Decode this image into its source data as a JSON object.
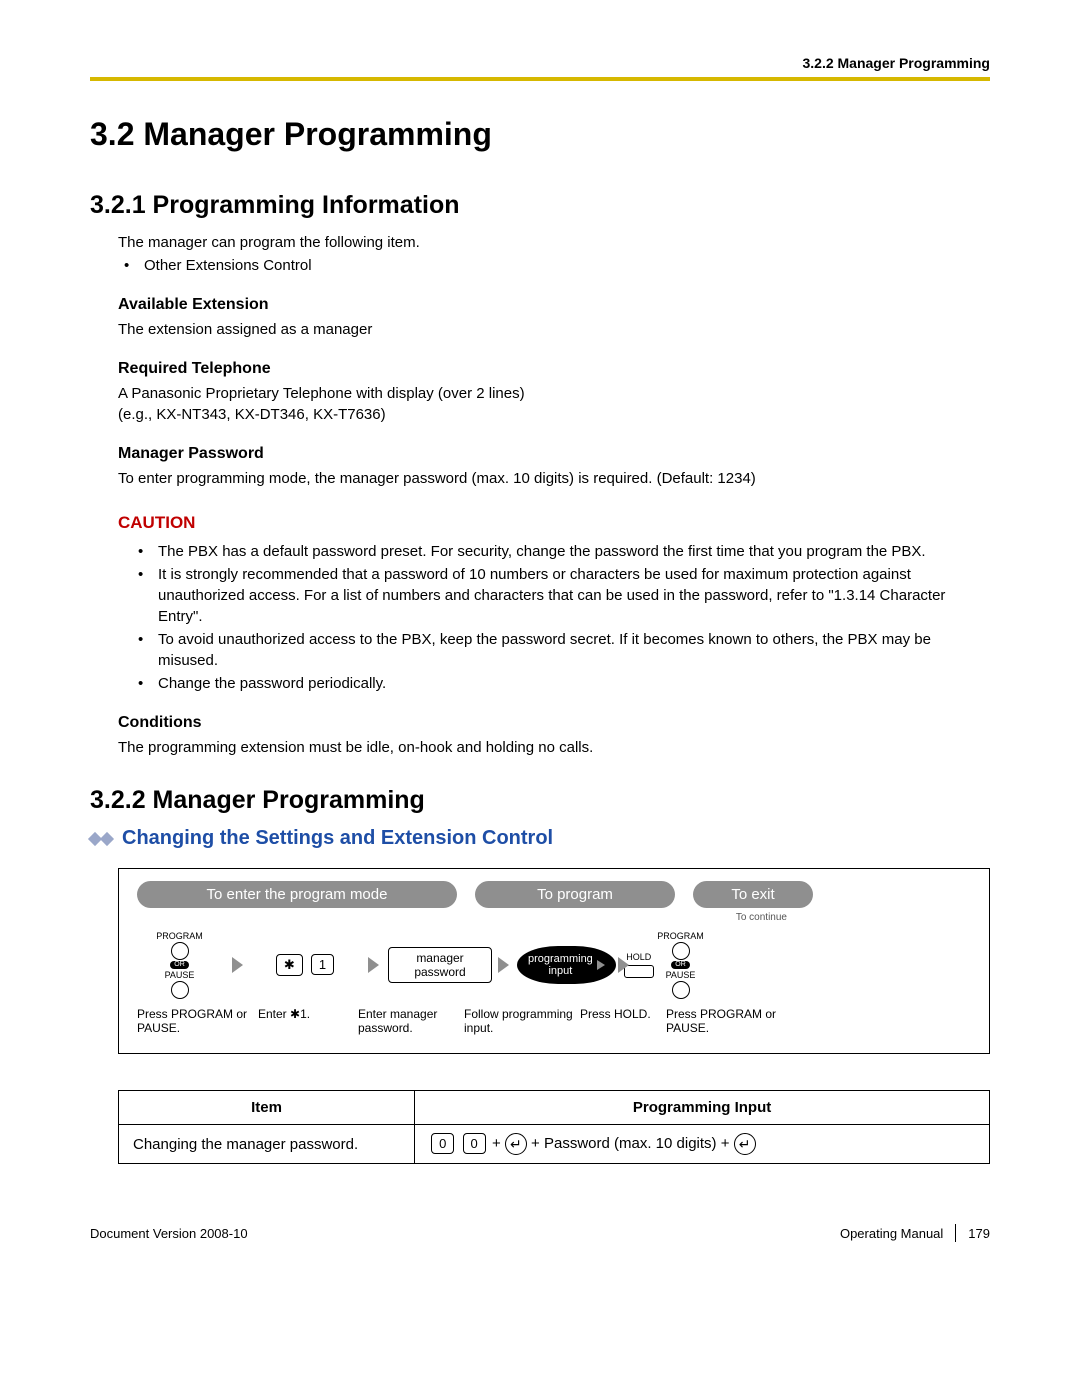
{
  "header": {
    "section_ref": "3.2.2 Manager Programming"
  },
  "h1": "3.2  Manager Programming",
  "s1": {
    "title": "3.2.1  Programming Information",
    "intro": "The manager can program the following item.",
    "intro_bullet": "Other Extensions Control",
    "available_ext_head": "Available Extension",
    "available_ext_body": "The extension assigned as a manager",
    "req_tel_head": "Required Telephone",
    "req_tel_body1": "A Panasonic Proprietary Telephone with display (over 2 lines)",
    "req_tel_body2": "(e.g., KX-NT343, KX-DT346, KX-T7636)",
    "mgr_pw_head": "Manager Password",
    "mgr_pw_body": "To enter programming mode, the manager password (max. 10 digits) is required. (Default: 1234)",
    "caution_label": "CAUTION",
    "caution": [
      "The PBX has a default password preset. For security, change the password the first time that you program the PBX.",
      "It is strongly recommended that a password of 10 numbers or characters be used for maximum protection against unauthorized access. For a list of numbers and characters that can be used in the password, refer to \"1.3.14  Character Entry\".",
      "To avoid unauthorized access to the PBX, keep the password secret. If it becomes known to others, the PBX may be misused.",
      "Change the password periodically."
    ],
    "cond_head": "Conditions",
    "cond_body": "The programming extension must be idle, on-hook and holding no calls."
  },
  "s2": {
    "title": "3.2.2  Manager Programming",
    "subtitle": "Changing the Settings and Extension Control",
    "pills": {
      "enter": "To enter the program mode",
      "program": "To program",
      "exit": "To exit"
    },
    "btn_program": "PROGRAM",
    "btn_or": "OR",
    "btn_pause": "PAUSE",
    "key_star": "✱",
    "key_one": "1",
    "field_mgrpw": "manager password",
    "oval_text": "programming input",
    "to_continue": "To continue",
    "hold_label": "HOLD",
    "captions": {
      "c1": "Press PROGRAM or PAUSE.",
      "c2": "Enter ✱1.",
      "c3": "Enter manager password.",
      "c4": "Follow programming input.",
      "c5": "Press HOLD.",
      "c6": "Press PROGRAM or PAUSE."
    }
  },
  "table": {
    "head_item": "Item",
    "head_input": "Programming Input",
    "row_item": "Changing the manager password.",
    "row_key0a": "0",
    "row_key0b": "0",
    "row_plus1": "+",
    "row_middle": "+ Password (max. 10 digits) +"
  },
  "footer": {
    "left": "Document Version  2008-10",
    "right_label": "Operating Manual",
    "page": "179"
  }
}
